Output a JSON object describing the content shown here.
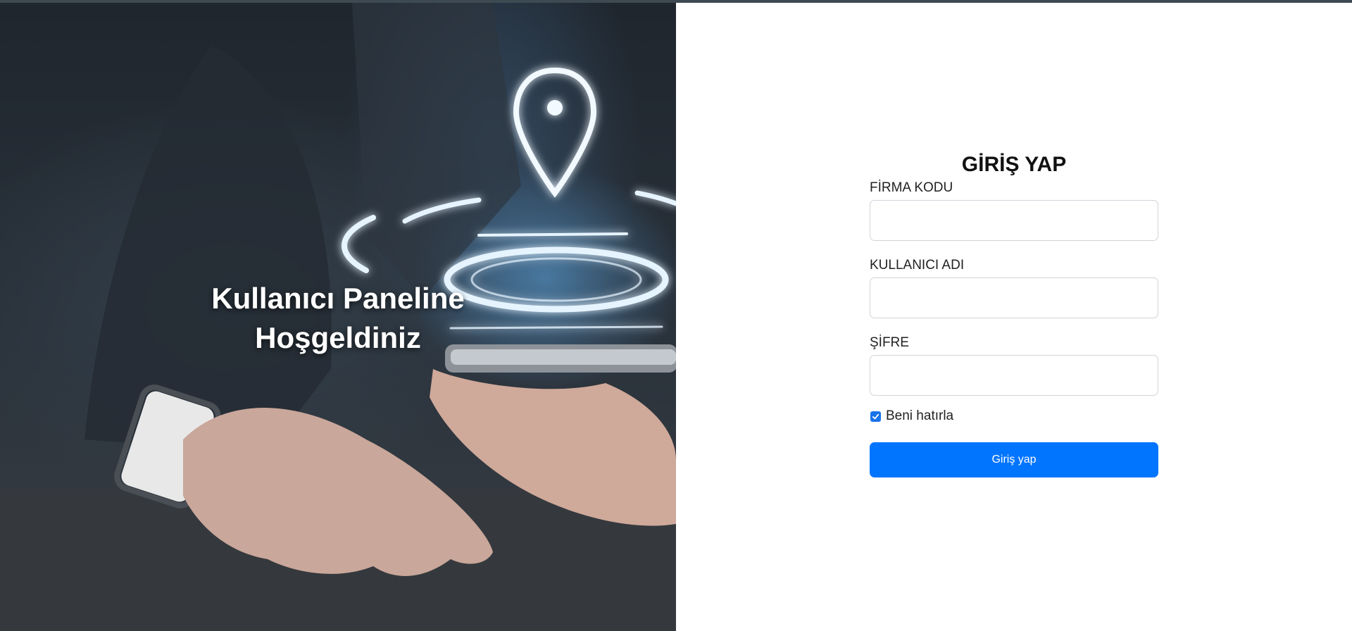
{
  "hero": {
    "title_line1": "Kullanıcı Paneline",
    "title_line2": "Hoşgeldiniz",
    "illustration_icon": "location-pin-icon"
  },
  "login": {
    "title": "GİRİŞ YAP",
    "fields": [
      {
        "label": "FİRMA KODU",
        "value": ""
      },
      {
        "label": "KULLANICI ADI",
        "value": ""
      },
      {
        "label": "ŞİFRE",
        "value": ""
      }
    ],
    "remember": {
      "label": "Beni hatırla",
      "checked": true
    },
    "submit_label": "Giriş yap"
  },
  "colors": {
    "primary": "#0275ff",
    "checkbox": "#1a73e8",
    "hero_glow": "#5faae6"
  }
}
